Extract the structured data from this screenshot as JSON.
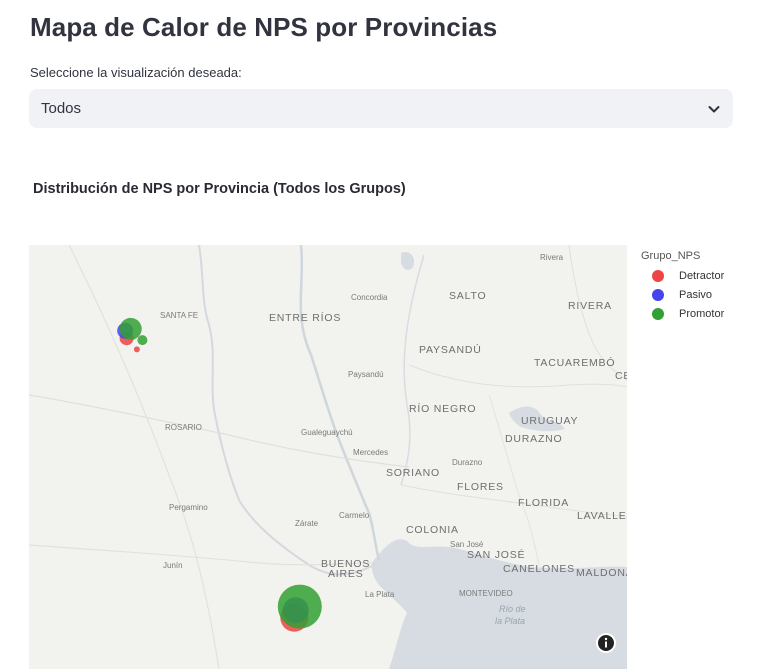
{
  "page": {
    "title": "Mapa de Calor de NPS por Provincias",
    "select_label": "Seleccione la visualización deseada:",
    "select_value": "Todos"
  },
  "chart": {
    "subtitle": "Distribución de NPS por Provincia (Todos los Grupos)",
    "legend_title": "Grupo_NPS",
    "colors": {
      "Detractor": "#ef4444",
      "Pasivo": "#4444ee",
      "Promotor": "#33a033"
    }
  },
  "map_labels": [
    {
      "text": "SALTO",
      "cls": "big"
    },
    {
      "text": "RIVERA",
      "cls": "big"
    },
    {
      "text": "ENTRE RÍOS",
      "cls": "big"
    },
    {
      "text": "SANTA FE",
      "cls": "small"
    },
    {
      "text": "PAYSANDÚ",
      "cls": "big"
    },
    {
      "text": "TACUAREMBÓ",
      "cls": "big"
    },
    {
      "text": "CE",
      "cls": "big"
    },
    {
      "text": "Concordia",
      "cls": "small"
    },
    {
      "text": "Rivera",
      "cls": "small"
    },
    {
      "text": "Paysandú",
      "cls": "small"
    },
    {
      "text": "RÍO NEGRO",
      "cls": "big"
    },
    {
      "text": "ROSARIO",
      "cls": "small"
    },
    {
      "text": "URUGUAY",
      "cls": "big"
    },
    {
      "text": "DURAZNO",
      "cls": "big"
    },
    {
      "text": "Gualeguaychú",
      "cls": "small"
    },
    {
      "text": "Mercedes",
      "cls": "small"
    },
    {
      "text": "SORIANO",
      "cls": "big"
    },
    {
      "text": "Durazno",
      "cls": "small"
    },
    {
      "text": "FLORES",
      "cls": "big"
    },
    {
      "text": "FLORIDA",
      "cls": "big"
    },
    {
      "text": "Pergamino",
      "cls": "small"
    },
    {
      "text": "LAVALLEJ",
      "cls": "big"
    },
    {
      "text": "Zárate",
      "cls": "small"
    },
    {
      "text": "Carmelo",
      "cls": "small"
    },
    {
      "text": "COLONIA",
      "cls": "big"
    },
    {
      "text": "San José",
      "cls": "small"
    },
    {
      "text": "SAN JOSÉ",
      "cls": "big"
    },
    {
      "text": "Junín",
      "cls": "small"
    },
    {
      "text": "BUENOS",
      "cls": "big"
    },
    {
      "text": "AIRES",
      "cls": "big"
    },
    {
      "text": "CANELONES",
      "cls": "big"
    },
    {
      "text": "MALDONA",
      "cls": "big"
    },
    {
      "text": "La Plata",
      "cls": "small"
    },
    {
      "text": "MONTEVIDEO",
      "cls": "small"
    },
    {
      "text": "Río de",
      "cls": "water"
    },
    {
      "text": "la Plata",
      "cls": "water"
    }
  ],
  "chart_data": {
    "type": "scatter",
    "title": "Distribución de NPS por Provincia (Todos los Grupos)",
    "legend_title": "Grupo_NPS",
    "legend_placement": "top-right",
    "series": [
      {
        "name": "Detractor",
        "color": "#ef4444",
        "points": [
          {
            "lon": -60.78,
            "lat": -31.7,
            "size": 7
          },
          {
            "lon": -60.63,
            "lat": -31.82,
            "size": 3
          },
          {
            "lon": -58.34,
            "lat": -34.7,
            "size": 14
          }
        ]
      },
      {
        "name": "Pasivo",
        "color": "#4444ee",
        "points": [
          {
            "lon": -60.8,
            "lat": -31.62,
            "size": 8
          },
          {
            "lon": -58.32,
            "lat": -34.62,
            "size": 13
          }
        ]
      },
      {
        "name": "Promotor",
        "color": "#33a033",
        "points": [
          {
            "lon": -60.72,
            "lat": -31.6,
            "size": 11
          },
          {
            "lon": -60.55,
            "lat": -31.72,
            "size": 5
          },
          {
            "lon": -58.26,
            "lat": -34.58,
            "size": 22
          }
        ]
      }
    ]
  }
}
